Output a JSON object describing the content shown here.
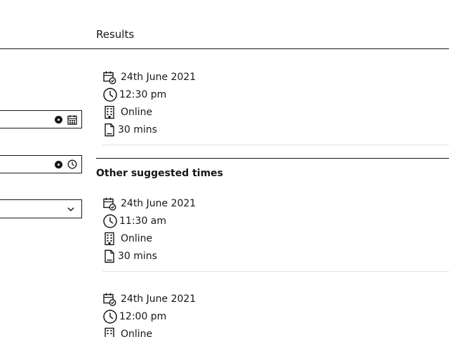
{
  "results": {
    "title": "Results",
    "primary": {
      "date": "24th June 2021",
      "time": "12:30 pm",
      "location": "Online",
      "duration": "30 mins"
    },
    "other_title": "Other suggested times",
    "suggestions": [
      {
        "date": "24th June 2021",
        "time": "11:30 am",
        "location": "Online",
        "duration": "30 mins"
      },
      {
        "date": "24th June 2021",
        "time": "12:00 pm",
        "location": "Online",
        "duration": ""
      }
    ]
  },
  "icons": {
    "date": "calendar-check-icon",
    "time": "clock-icon",
    "location": "building-icon",
    "duration": "document-icon"
  }
}
